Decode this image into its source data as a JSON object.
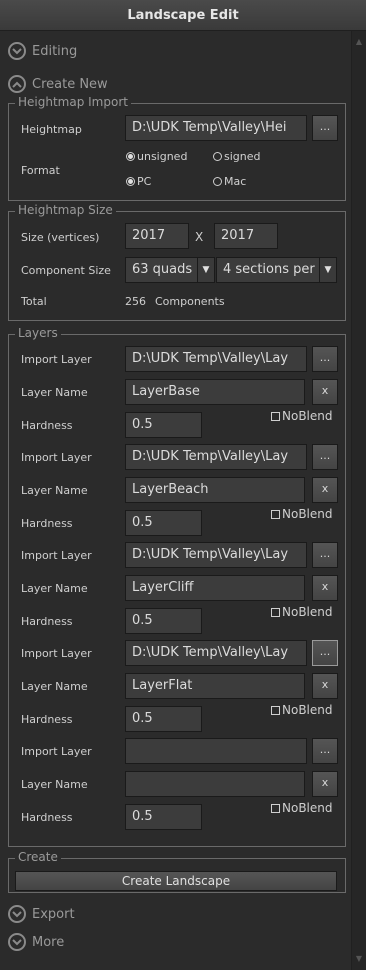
{
  "window": {
    "title": "Landscape Edit"
  },
  "sections": {
    "editing": "Editing",
    "create_new": "Create New",
    "export": "Export",
    "more": "More"
  },
  "heightmap_import": {
    "legend": "Heightmap Import",
    "heightmap_label": "Heightmap",
    "heightmap_value": "D:\\UDK Temp\\Valley\\Hei",
    "browse_label": "...",
    "format_label": "Format",
    "unsigned": "unsigned",
    "signed": "signed",
    "pc": "PC",
    "mac": "Mac",
    "selected_sign": "unsigned",
    "selected_platform": "PC"
  },
  "heightmap_size": {
    "legend": "Heightmap Size",
    "size_label": "Size (vertices)",
    "size_x": "2017",
    "x_sep": "X",
    "size_y": "2017",
    "component_size_label": "Component Size",
    "quads_value": "63 quads",
    "sections_value": "4 sections per c",
    "total_label": "Total",
    "total_value": "256",
    "total_unit": "Components"
  },
  "layers": {
    "legend": "Layers",
    "import_label": "Import Layer",
    "name_label": "Layer Name",
    "hardness_label": "Hardness",
    "browse_label": "...",
    "remove_label": "x",
    "noblend_label": "NoBlend",
    "items": [
      {
        "import_path": "D:\\UDK Temp\\Valley\\Lay",
        "name": "LayerBase",
        "hardness": "0.5"
      },
      {
        "import_path": "D:\\UDK Temp\\Valley\\Lay",
        "name": "LayerBeach",
        "hardness": "0.5"
      },
      {
        "import_path": "D:\\UDK Temp\\Valley\\Lay",
        "name": "LayerCliff",
        "hardness": "0.5"
      },
      {
        "import_path": "D:\\UDK Temp\\Valley\\Lay",
        "name": "LayerFlat",
        "hardness": "0.5"
      },
      {
        "import_path": "",
        "name": "",
        "hardness": "0.5"
      }
    ]
  },
  "create": {
    "legend": "Create",
    "button_label": "Create Landscape"
  }
}
